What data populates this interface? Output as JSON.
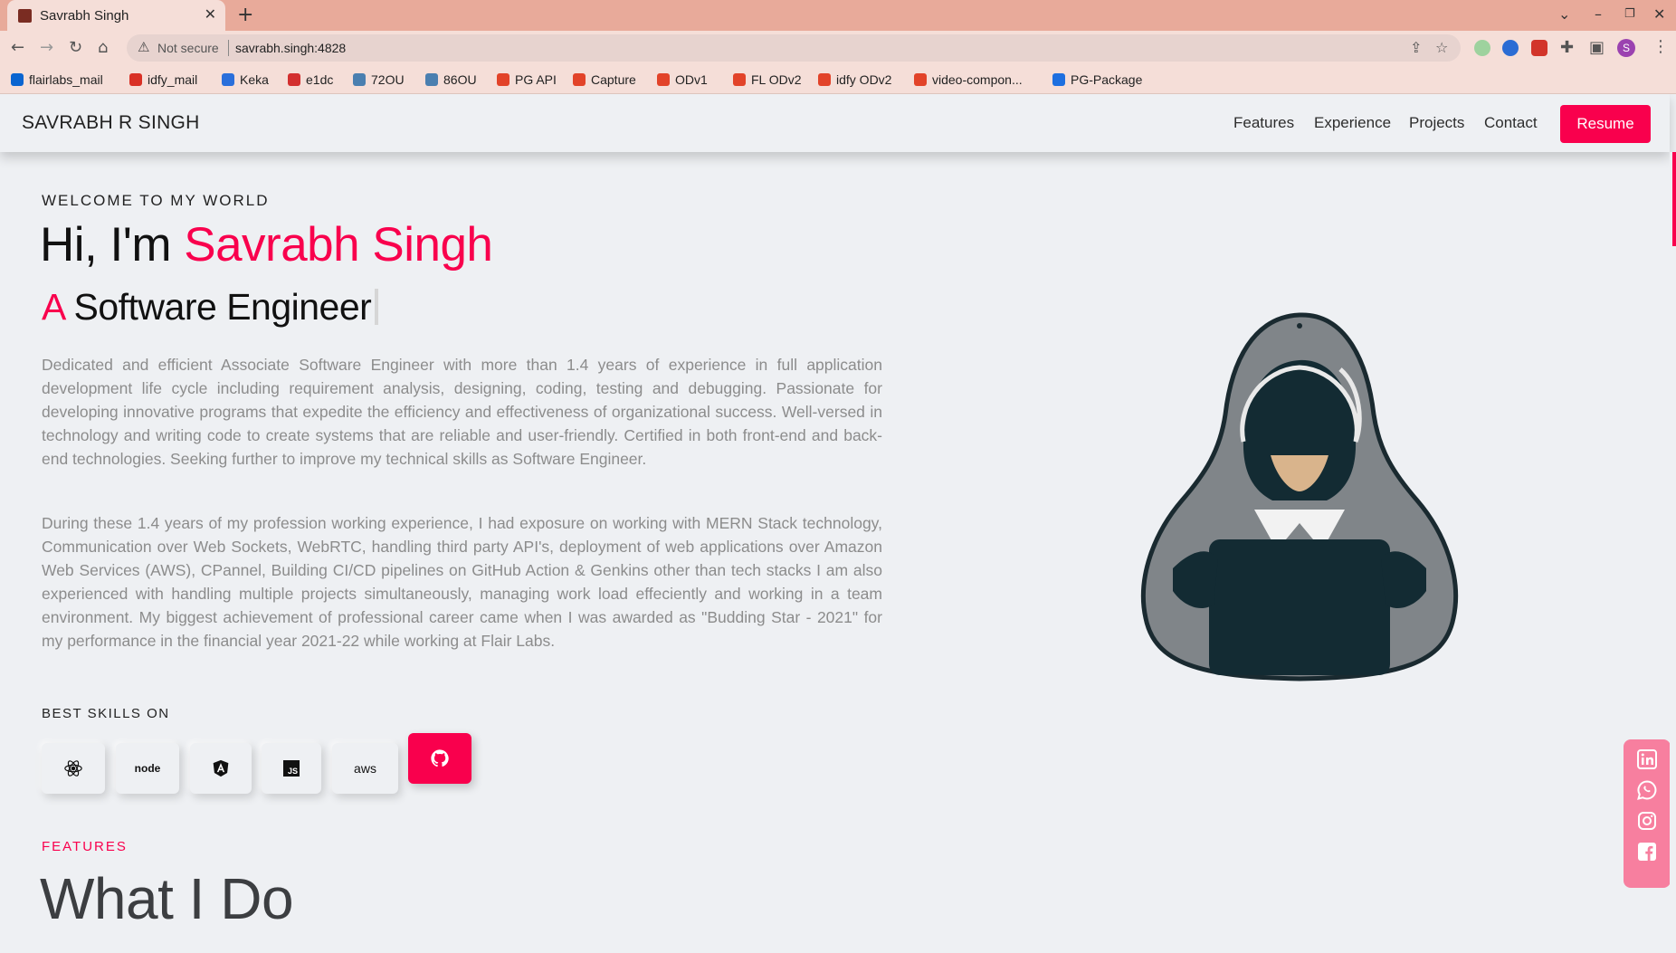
{
  "browser": {
    "tab_title": "Savrabh Singh",
    "security_label": "Not secure",
    "url": "savrabh.singh:4828",
    "profile_initial": "S",
    "bookmarks": [
      {
        "label": "flairlabs_mail",
        "color": "#0a64d0"
      },
      {
        "label": "idfy_mail",
        "color": "#d93025"
      },
      {
        "label": "Keka",
        "color": "#2a6fdb"
      },
      {
        "label": "e1dc",
        "color": "#d32f2f"
      },
      {
        "label": "72OU",
        "color": "#4a7fb0"
      },
      {
        "label": "86OU",
        "color": "#4a7fb0"
      },
      {
        "label": "PG API",
        "color": "#e24329"
      },
      {
        "label": "Capture",
        "color": "#e24329"
      },
      {
        "label": "ODv1",
        "color": "#e24329"
      },
      {
        "label": "FL ODv2",
        "color": "#e24329"
      },
      {
        "label": "idfy ODv2",
        "color": "#e24329"
      },
      {
        "label": "video-compon...",
        "color": "#e24329"
      },
      {
        "label": "PG-Package",
        "color": "#1d6fe0"
      }
    ]
  },
  "header": {
    "brand": "SAVRABH R SINGH",
    "nav": [
      "Features",
      "Experience",
      "Projects",
      "Contact"
    ],
    "resume": "Resume"
  },
  "hero": {
    "welcome": "WELCOME TO MY WORLD",
    "greeting": "Hi, I'm ",
    "name": "Savrabh Singh",
    "role_prefix": "A",
    "role": "Software Engineer",
    "para1": "Dedicated and efficient Associate Software Engineer with more than 1.4 years of experience in full application development life cycle including requirement analysis, designing, coding, testing and debugging. Passionate for developing innovative programs that expedite the efficiency and effectiveness of organizational success. Well-versed in technology and writing code to create systems that are reliable and user-friendly. Certified in both front-end and back-end technologies. Seeking further to improve my technical skills as Software Engineer.",
    "para2": "During these 1.4 years of my profession working experience, I had exposure on working with MERN Stack technology, Communication over Web Sockets, WebRTC, handling third party API's, deployment of web applications over Amazon Web Services (AWS), CPannel, Building CI/CD pipelines on GitHub Action & Genkins other than tech stacks I am also experienced with handling multiple projects simultaneously, managing work load effeciently and working in a team environment. My biggest achievement of professional career came when I was awarded as \"Budding Star - 2021\" for my performance in the financial year 2021-22 while working at Flair Labs.",
    "skills_title": "BEST SKILLS ON",
    "skills": [
      {
        "icon": "react-icon"
      },
      {
        "icon": "node-icon",
        "text": "node"
      },
      {
        "icon": "angular-icon"
      },
      {
        "icon": "javascript-icon",
        "text": "JS"
      },
      {
        "icon": "aws-icon",
        "text": "aws"
      },
      {
        "icon": "github-icon"
      }
    ]
  },
  "features": {
    "label": "FEATURES",
    "title": "What I Do"
  },
  "social": [
    "linkedin-icon",
    "whatsapp-icon",
    "instagram-icon",
    "facebook-icon"
  ],
  "colors": {
    "accent": "#f9004d",
    "background": "#eef0f3",
    "social_bg": "#f77f9f"
  }
}
